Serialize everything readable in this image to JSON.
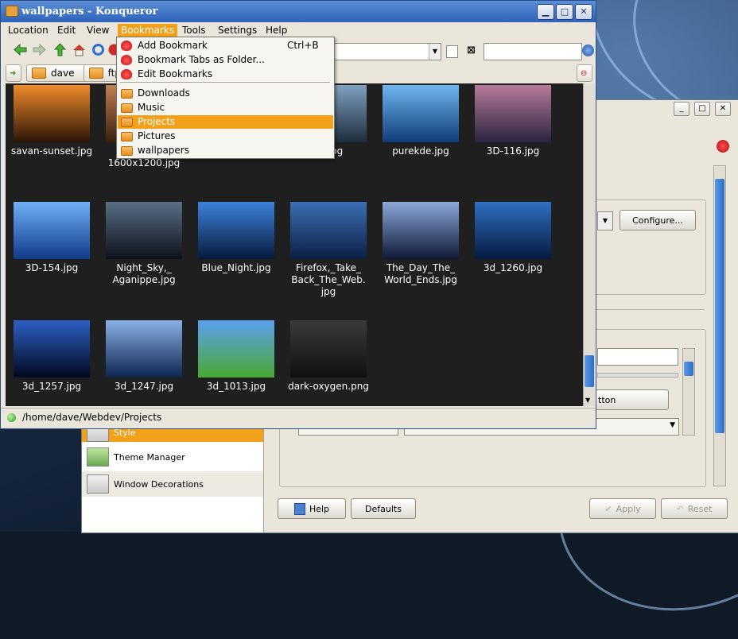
{
  "window": {
    "title": "wallpapers - Konqueror",
    "controls": {
      "minimize": "▁",
      "maximize": "□",
      "close": "✕"
    }
  },
  "menubar": [
    "Location",
    "Edit",
    "View",
    "Bookmarks",
    "Tools",
    "Settings",
    "Help"
  ],
  "bookmarks_menu": {
    "items": [
      {
        "label": "Add Bookmark",
        "shortcut": "Ctrl+B",
        "icon": "bookmark-add-icon"
      },
      {
        "label": "Bookmark Tabs as Folder...",
        "shortcut": "",
        "icon": "bookmark-folder-icon"
      },
      {
        "label": "Edit Bookmarks",
        "shortcut": "",
        "icon": "bookmark-edit-icon"
      },
      {
        "label": "Downloads",
        "shortcut": "",
        "icon": "folder-icon"
      },
      {
        "label": "Music",
        "shortcut": "",
        "icon": "folder-icon"
      },
      {
        "label": "Projects",
        "shortcut": "",
        "icon": "folder-icon",
        "selected": true
      },
      {
        "label": "Pictures",
        "shortcut": "",
        "icon": "folder-icon"
      },
      {
        "label": "wallpapers",
        "shortcut": "",
        "icon": "folder-icon"
      }
    ]
  },
  "bookmark_toolbar": {
    "items": [
      "dave",
      "ftp"
    ]
  },
  "files": [
    {
      "name": "savan-sunset.jpg",
      "colors": [
        "#f08a2a",
        "#2b1507"
      ]
    },
    {
      "name": "lasers-\n1600x1200.jpg",
      "colors": [
        "#c08050",
        "#3a2010"
      ]
    },
    {
      "name": "",
      "colors": [
        "#1a1a1a",
        "#1a1a1a"
      ]
    },
    {
      "name": "all.jpg",
      "colors": [
        "#7fa0c0",
        "#1e2d3d"
      ]
    },
    {
      "name": "purekde.jpg",
      "colors": [
        "#6fb6f0",
        "#0f3c78"
      ]
    },
    {
      "name": "3D-116.jpg",
      "colors": [
        "#b77a9a",
        "#2a2440"
      ]
    },
    {
      "name": "3D-154.jpg",
      "colors": [
        "#6fb0f5",
        "#103a8a"
      ]
    },
    {
      "name": "Night_Sky,_\nAganippe.jpg",
      "colors": [
        "#5a6e85",
        "#0c121c"
      ]
    },
    {
      "name": "Blue_Night.jpg",
      "colors": [
        "#3c83dc",
        "#071a3c"
      ]
    },
    {
      "name": "Firefox,_Take_\nBack_The_Web.\njpg",
      "colors": [
        "#3c6fb4",
        "#0c1f45"
      ]
    },
    {
      "name": "The_Day_The_\nWorld_Ends.jpg",
      "colors": [
        "#8aa8d8",
        "#101838"
      ]
    },
    {
      "name": "3d_1260.jpg",
      "colors": [
        "#2f6fc2",
        "#061a40"
      ]
    },
    {
      "name": "3d_1257.jpg",
      "colors": [
        "#2d5fc4",
        "#02081f"
      ]
    },
    {
      "name": "3d_1247.jpg",
      "colors": [
        "#8ab2e6",
        "#0d2450"
      ]
    },
    {
      "name": "3d_1013.jpg",
      "colors": [
        "#5aa0ee",
        "#48a832"
      ]
    },
    {
      "name": "dark-oxygen.png",
      "colors": [
        "#3a3a3a",
        "#101010"
      ]
    }
  ],
  "status": {
    "path": "/home/dave/Webdev/Projects"
  },
  "control_center": {
    "sidebar": [
      "Style",
      "Theme Manager",
      "Window Decorations"
    ],
    "buttons": {
      "configure": "Configure...",
      "button_fragment": "tton",
      "help": "Help",
      "defaults": "Defaults",
      "apply": "Apply",
      "reset": "Reset"
    }
  },
  "colors": {
    "accent": "#f3a11a",
    "titlebar": "#3e74c8"
  }
}
